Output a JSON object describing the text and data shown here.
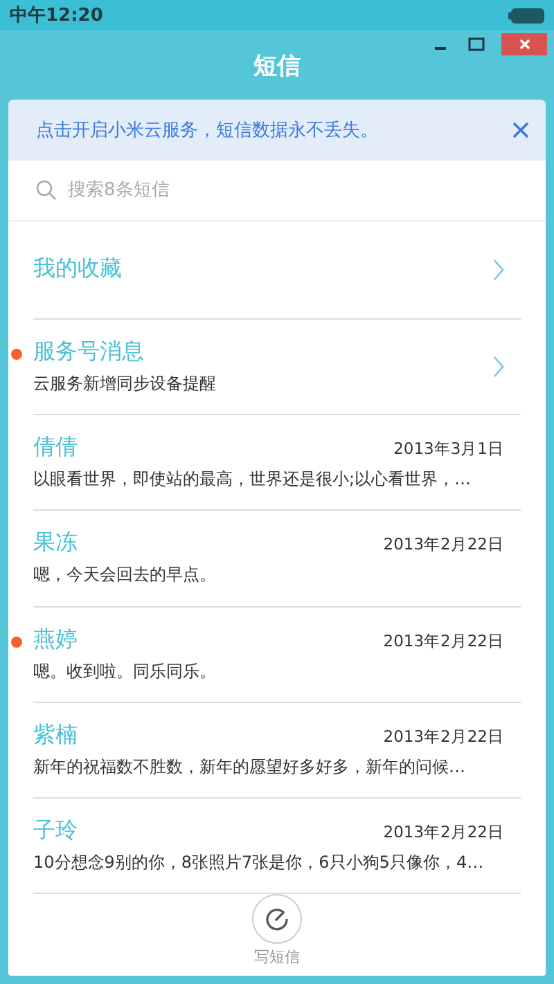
{
  "status_bar": {
    "time": "中午12:20"
  },
  "window": {
    "title": "短信"
  },
  "banner": {
    "text": "点击开启小米云服务，短信数据永不丢失。"
  },
  "search": {
    "placeholder": "搜索8条短信"
  },
  "threads": [
    {
      "kind": "folder",
      "name": "我的收藏",
      "unread": false
    },
    {
      "kind": "folder",
      "name": "服务号消息",
      "preview": "云服务新增同步设备提醒",
      "unread": true
    },
    {
      "kind": "conversation",
      "name": "倩倩",
      "date": "2013年3月1日",
      "preview": "以眼看世界，即使站的最高，世界还是很小;以心看世界，…",
      "unread": false
    },
    {
      "kind": "conversation",
      "name": "果冻",
      "date": "2013年2月22日",
      "preview": "嗯，今天会回去的早点。",
      "unread": false
    },
    {
      "kind": "conversation",
      "name": "燕婷",
      "date": "2013年2月22日",
      "preview": "嗯。收到啦。同乐同乐。",
      "unread": true
    },
    {
      "kind": "conversation",
      "name": "紫楠",
      "date": "2013年2月22日",
      "preview": "新年的祝福数不胜数，新年的愿望好多好多，新年的问候…",
      "unread": false
    },
    {
      "kind": "conversation",
      "name": "子玲",
      "date": "2013年2月22日",
      "preview": "10分想念9别的你，8张照片7张是你，6只小狗5只像你，4…",
      "unread": false
    }
  ],
  "compose": {
    "label": "写短信"
  }
}
